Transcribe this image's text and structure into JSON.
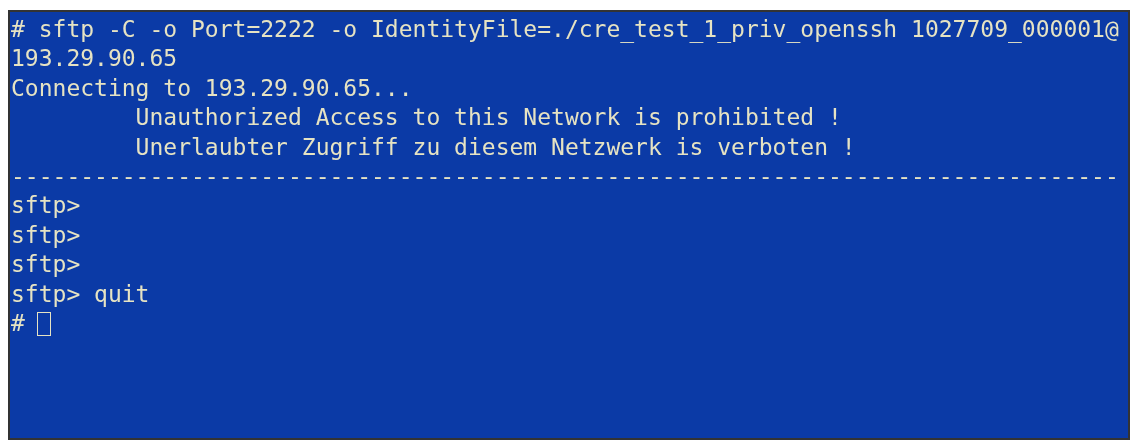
{
  "terminal": {
    "lines": [
      "# sftp -C -o Port=2222 -o IdentityFile=./cre_test_1_priv_openssh 1027709_000001@",
      "193.29.90.65",
      "Connecting to 193.29.90.65...",
      "         Unauthorized Access to this Network is prohibited !",
      "         Unerlaubter Zugriff zu diesem Netzwerk is verboten !",
      "--------------------------------------------------------------------------------",
      "sftp>",
      "sftp>",
      "sftp>",
      "sftp> quit"
    ],
    "prompt": {
      "text": "#",
      "cursor": true
    }
  }
}
